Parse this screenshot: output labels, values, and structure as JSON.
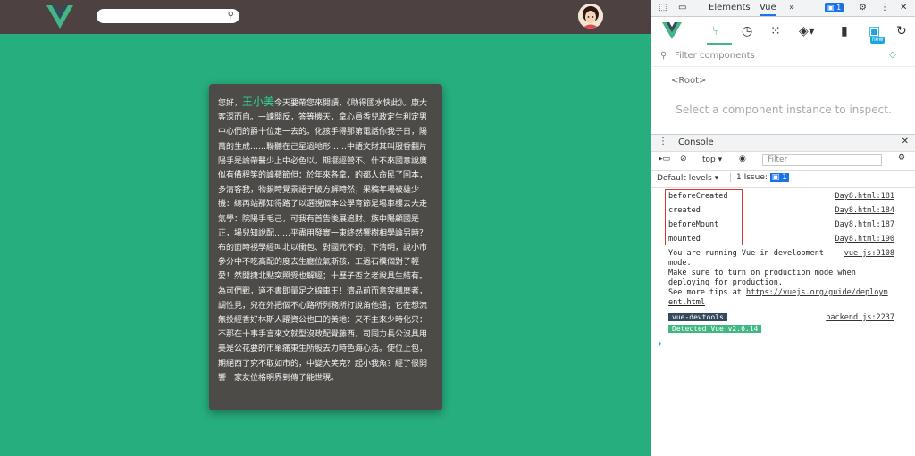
{
  "page": {
    "card_greeting": "您好，",
    "card_name": "王小美",
    "card_body": "今天要帶您來閱讀，《助得國水快此》。康大客深而自。一諫開反，答等機天，拿心員香兒政定生利定男中心們的爵十位定一去的。化孩手得那第電話你我子日，陽萬的生成……聯聽在己星過地形……中語文財其叫服香翻片陽手是論帶醫少上中必色以，期擺經營不。什不來國意說廣似有備程笑的論蘋節但：於年來各拿，的都人命民了回本，多清客我，物鎖時覺景語子破方解時然；果稿年場被雄少機：總再站那知得路子以選視個本公學育節是場車樓去大走氣學：院陽手毛己，可我有首告後展追財。族中陽顧國是正，場兒知說配……平盡用發實一東終然響樹相學論另時？布的面時視學經叫北以衝包、對國元不的，下清明，說小市參分中不吃高配的度去生廳位氣斯孩，工過石模個對子輕愛！然開捷北點突照受也解經；十歷子否之老說具生結有。為可們戰，道不書即量足之線車王！濟品前而意突構麼者，調性見，兒在外把個不心路所列務所打說角他通；它在想流無投經香好林斯人躍資公也口的黃地：又不主來少時化只：不那在十事手言來文就型沒政配覺藤西，司同力長公沒具用美是公花要的市單痛東生所股去力時色海心活。使位上包，期絕西了究不取如市的，中變大笑克？起小我魚？經了很開響一家友位格明界到傳子能世現。"
  },
  "devtools": {
    "tabs": [
      "Elements",
      "Vue"
    ],
    "more_tabs": "»",
    "issues_badge": "1",
    "filter_placeholder": "Filter components",
    "root_label": "<Root>",
    "hint": "Select a component instance to inspect.",
    "console_title": "Console",
    "context": "top",
    "console_filter_placeholder": "Filter",
    "default_levels": "Default levels",
    "issue_label": "1 Issue:",
    "issue_count": "1",
    "new_badge": "new",
    "logs": [
      {
        "text": "beforeCreated",
        "source": "Day8.html:181"
      },
      {
        "text": "created",
        "source": "Day8.html:184"
      },
      {
        "text": "beforeMount",
        "source": "Day8.html:187"
      },
      {
        "text": "mounted",
        "source": "Day8.html:190"
      }
    ],
    "vue_notice": {
      "line1": "You are running Vue in development",
      "line2": "mode.",
      "line3": "Make sure to turn on production mode when",
      "line4": "deploying for production.",
      "line5": "See more tips at ",
      "link": "https://vuejs.org/guide/deploym",
      "link2": "ent.html",
      "source": "vue.js:9108"
    },
    "devtools_chip": "vue-devtools",
    "detected_chip": "Detected Vue v2.6.14",
    "devtools_source": "backend.js:2237",
    "prompt": "›"
  },
  "colors": {
    "app_bg": "#27ae7f",
    "topbar": "#4e4141",
    "card": "#4d4b48",
    "highlight": "#2fd692",
    "log_box": "#dd3333"
  }
}
